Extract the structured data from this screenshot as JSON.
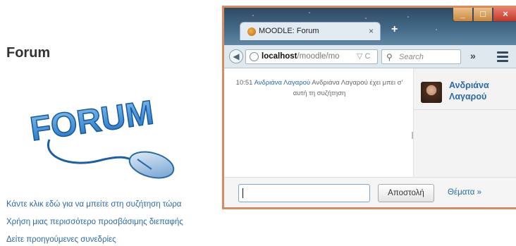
{
  "page": {
    "title": "Forum",
    "logo_text": "FORUM",
    "links": [
      "Κάντε κλικ εδώ για να μπείτε στη συζήτηση τώρα",
      "Χρήση μιας περισσότερο προσβάσιμης διεπαφής",
      "Δείτε προηγούμενες συνεδρίες"
    ]
  },
  "browser": {
    "tab_title": "MOODLE: Forum",
    "tab_close": "×",
    "new_tab": "+",
    "url_host": "localhost",
    "url_path": "/moodle/mo",
    "url_actions": "▽ C",
    "search_placeholder": "Search",
    "overflow": "»",
    "window_controls": {
      "minimize": "_",
      "maximize": "□",
      "close": "×"
    }
  },
  "chat": {
    "message": {
      "time": "10:51",
      "user": "Ανδριάνα Λαγαρού",
      "text": "Ανδριάνα Λαγαρού έχει μπει σ' αυτή τη συζήτηση"
    },
    "users": [
      {
        "name_line1": "Ανδριάνα",
        "name_line2": "Λαγαρού"
      }
    ],
    "input_value": "",
    "send_label": "Αποστολή",
    "themes_label": "Θέματα »"
  },
  "colors": {
    "link": "#2a6aa8",
    "window_border": "#d98a5e",
    "titlebar": "#436986"
  },
  "icons": [
    "forum-logo",
    "back-arrow-icon",
    "globe-icon",
    "search-icon",
    "menu-icon",
    "firefox-icon"
  ]
}
